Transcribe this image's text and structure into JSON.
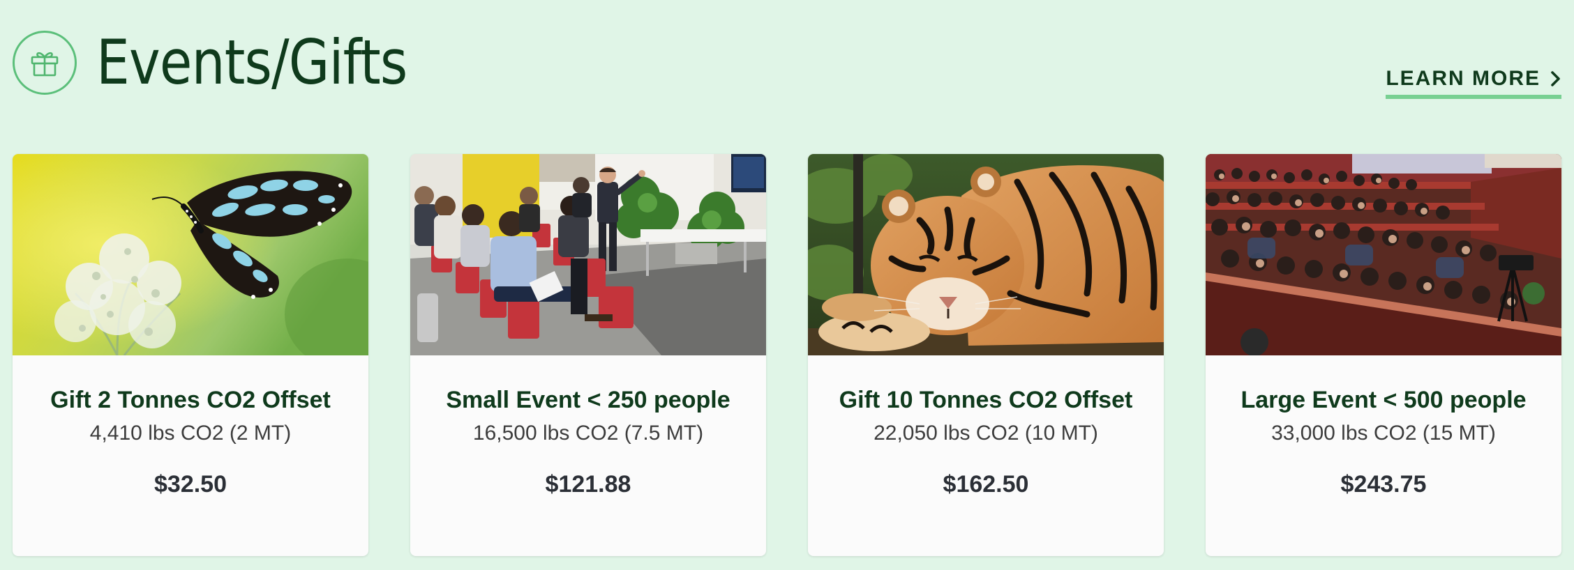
{
  "section": {
    "title": "Events/Gifts",
    "icon": "gift-icon",
    "learn_more_label": "LEARN MORE",
    "learn_more_icon": "chevron-right-icon",
    "accent_color": "#78d092",
    "title_color": "#0f3a1c",
    "background_color": "#e0f5e7"
  },
  "cards": [
    {
      "title": "Gift 2 Tonnes CO2 Offset",
      "subtitle": "4,410 lbs CO2 (2 MT)",
      "price": "$32.50",
      "image": "butterfly-photo"
    },
    {
      "title": "Small Event < 250 people",
      "subtitle": "16,500 lbs CO2 (7.5 MT)",
      "price": "$121.88",
      "image": "conference-room-photo"
    },
    {
      "title": "Gift 10 Tonnes CO2 Offset",
      "subtitle": "22,050 lbs CO2 (10 MT)",
      "price": "$162.50",
      "image": "tiger-photo"
    },
    {
      "title": "Large Event < 500 people",
      "subtitle": "33,000 lbs CO2 (15 MT)",
      "price": "$243.75",
      "image": "auditorium-audience-photo"
    }
  ]
}
